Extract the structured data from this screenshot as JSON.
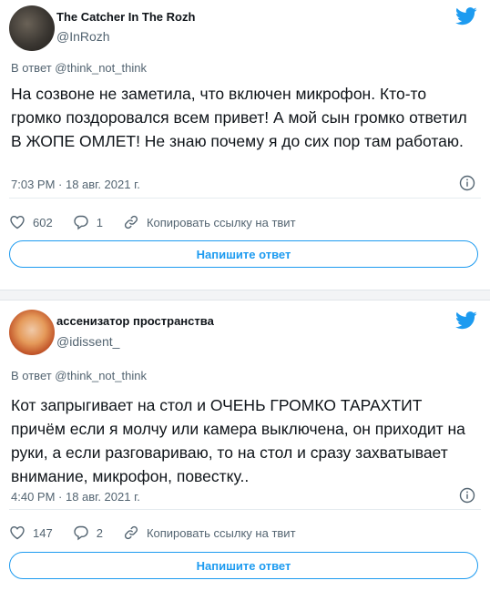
{
  "colors": {
    "accent": "#1d9bf0",
    "text": "#0f1419",
    "muted": "#536471"
  },
  "tweets": [
    {
      "author": "The Catcher In The Rozh",
      "handle": "@InRozh",
      "reply_to": "В ответ @think_not_think",
      "text": "На созвоне не заметила, что включен микрофон. Кто-то громко поздоровался всем привет! А мой сын громко ответил В ЖОПЕ ОМЛЕТ! Не знаю почему я до сих пор там работаю.",
      "timestamp": "7:03 PM · 18 авг. 2021 г.",
      "likes": "602",
      "replies": "1",
      "copy_link": "Копировать ссылку на твит",
      "reply_button": "Напишите ответ",
      "icons": {
        "brand": "twitter-bird-icon",
        "info": "info-icon",
        "like": "heart-icon",
        "reply": "speech-bubble-icon",
        "share": "link-icon"
      }
    },
    {
      "author": "ассенизатор пространства",
      "handle": "@idissent_",
      "reply_to": "В ответ @think_not_think",
      "text": "Кот запрыгивает на стол и ОЧЕНЬ ГРОМКО ТАРАХТИТ причём если я молчу или камера выключена, он приходит на руки, а если разговариваю, то на стол и сразу захватывает внимание, микрофон, повестку..",
      "timestamp": "4:40 PM · 18 авг. 2021 г.",
      "likes": "147",
      "replies": "2",
      "copy_link": "Копировать ссылку на твит",
      "reply_button": "Напишите ответ",
      "icons": {
        "brand": "twitter-bird-icon",
        "info": "info-icon",
        "like": "heart-icon",
        "reply": "speech-bubble-icon",
        "share": "link-icon"
      }
    }
  ]
}
